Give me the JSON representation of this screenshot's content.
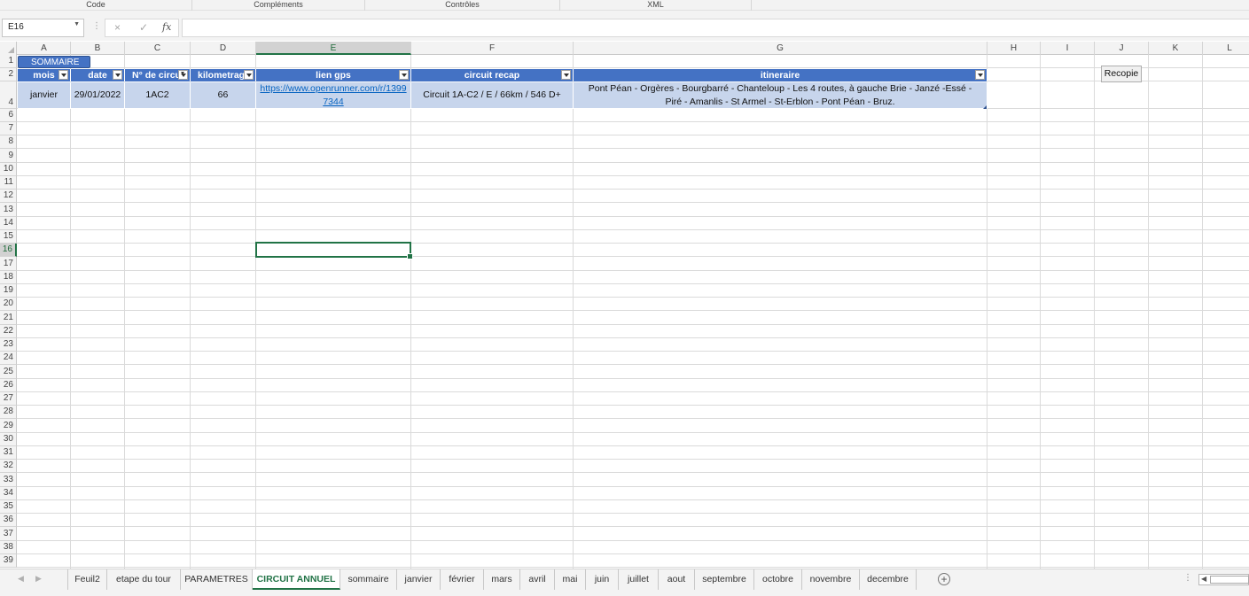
{
  "ribbon_groups": [
    "Code",
    "Compléments",
    "Contrôles",
    "XML"
  ],
  "formula_bar": {
    "name_box": "E16",
    "cancel_icon": "×",
    "enter_icon": "✓",
    "fx_label": "fx",
    "formula": ""
  },
  "columns": [
    "A",
    "B",
    "C",
    "D",
    "E",
    "F",
    "G",
    "H",
    "I",
    "J",
    "K",
    "L"
  ],
  "selected_column": "E",
  "rows": [
    "1",
    "2",
    "4",
    "6",
    "7",
    "8",
    "9",
    "10",
    "11",
    "12",
    "13",
    "14",
    "15",
    "16",
    "17",
    "18",
    "19",
    "20",
    "21",
    "22",
    "23",
    "24",
    "25",
    "26",
    "27",
    "28",
    "29",
    "30",
    "31",
    "32",
    "33",
    "34",
    "35",
    "36",
    "37",
    "38",
    "39"
  ],
  "selected_row": "16",
  "sommaire_button": "SOMMAIRE",
  "table": {
    "headers": [
      "mois",
      "date",
      "N° de circuit",
      "kilometrage",
      "lien gps",
      "circuit recap",
      "itineraire"
    ],
    "row": {
      "mois": "janvier",
      "date": "29/01/2022",
      "circuit": "1AC2",
      "km": "66",
      "gps": "https://www.openrunner.com/r/13997344",
      "recap": "Circuit 1A-C2 / E / 66km / 546 D+",
      "itineraire": "Pont Péan - Orgères - Bourgbarré - Chanteloup - Les 4 routes, à gauche Brie - Janzé -Essé - Piré - Amanlis - St Armel - St-Erblon - Pont Péan - Bruz."
    }
  },
  "recopie_button": "Recopie",
  "sheet_tabs": [
    "Feuil2",
    "etape du tour",
    "PARAMETRES",
    "CIRCUIT ANNUEL",
    "sommaire",
    "janvier",
    "février",
    "mars",
    "avril",
    "mai",
    "juin",
    "juillet",
    "aout",
    "septembre",
    "octobre",
    "novembre",
    "decembre"
  ],
  "active_tab": "CIRCUIT ANNUEL",
  "colors": {
    "table_header": "#4472c4",
    "table_row": "#c7d5ec",
    "excel_green": "#217346",
    "link": "#0563c1"
  }
}
